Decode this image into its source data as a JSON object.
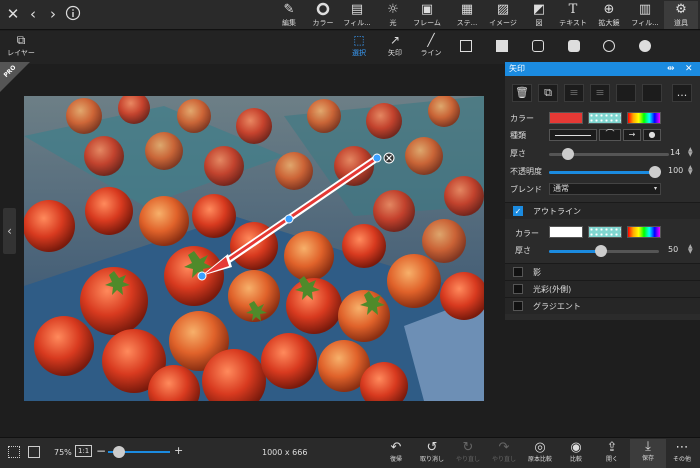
{
  "top_toolbar": {
    "tools": [
      {
        "label": "編集",
        "icon": "edit-icon"
      },
      {
        "label": "カラー",
        "icon": "color-ring-icon"
      },
      {
        "label": "フィル...",
        "icon": "filter-doc-icon"
      },
      {
        "label": "光",
        "icon": "sun-icon"
      },
      {
        "label": "フレーム",
        "icon": "frame-icon"
      },
      {
        "label": "ステ...",
        "icon": "sticker-icon"
      },
      {
        "label": "イメージ",
        "icon": "image-icon"
      },
      {
        "label": "図",
        "icon": "shapes-icon"
      },
      {
        "label": "テキスト",
        "icon": "text-icon"
      },
      {
        "label": "拡大鏡",
        "icon": "magnifier-icon"
      },
      {
        "label": "フィル...",
        "icon": "fill-icon"
      },
      {
        "label": "道具",
        "icon": "tools-icon"
      }
    ]
  },
  "sub_toolbar": {
    "layer_label": "レイヤー",
    "tools": [
      {
        "label": "選択",
        "icon": "select-icon"
      },
      {
        "label": "矢印",
        "icon": "arrow-icon"
      },
      {
        "label": "ライン",
        "icon": "line-icon"
      }
    ]
  },
  "pro_badge": "PRO",
  "panel": {
    "title": "矢印",
    "more_label": "...",
    "color_label": "カラー",
    "type_label": "種類",
    "thickness_label": "厚さ",
    "thickness_value": "14",
    "opacity_label": "不透明度",
    "opacity_value": "100",
    "blend_label": "ブレンド",
    "blend_value": "通常",
    "outline_label": "アウトライン",
    "outline_color_label": "カラー",
    "outline_thickness_label": "厚さ",
    "outline_thickness_value": "50",
    "shadow_label": "影",
    "glow_label": "光彩(外側)",
    "gradient_label": "グラジエント",
    "colors": {
      "accent": "#1b8be0",
      "arrow_red": "#e53935",
      "outline_white": "#ffffff",
      "teal": "#7fd6d0"
    }
  },
  "bottom_toolbar": {
    "zoom": "75%",
    "fit_label": "1:1",
    "dimensions": "1000 x 666",
    "buttons": [
      {
        "label": "復帰",
        "icon": "revert-icon"
      },
      {
        "label": "取り消し",
        "icon": "undo-icon"
      },
      {
        "label": "やり直し",
        "icon": "redo-icon"
      },
      {
        "label": "やり直し",
        "icon": "redo-all-icon"
      },
      {
        "label": "原本比較",
        "icon": "compare-original-icon"
      },
      {
        "label": "比較",
        "icon": "compare-icon"
      },
      {
        "label": "開く",
        "icon": "open-icon"
      },
      {
        "label": "保存",
        "icon": "save-icon"
      },
      {
        "label": "その他",
        "icon": "more-icon"
      }
    ]
  }
}
